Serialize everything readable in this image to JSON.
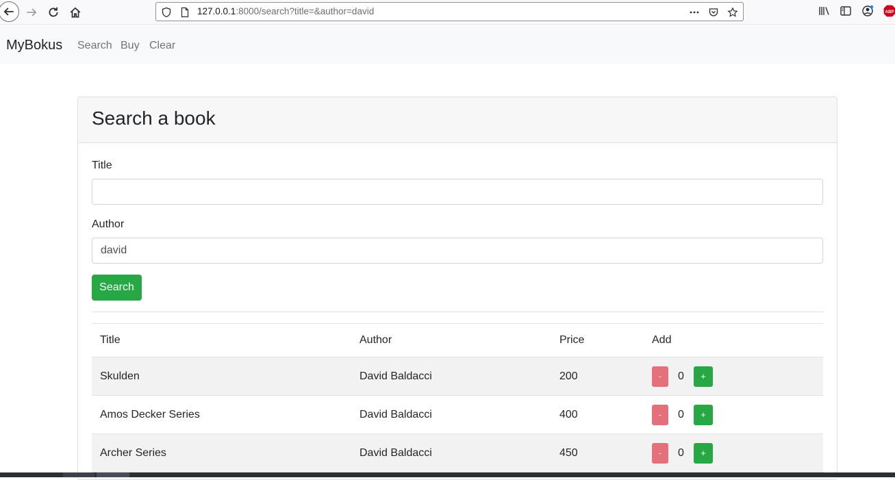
{
  "browser": {
    "url_host": "127.0.0.1",
    "url_rest": ":8000/search?title=&author=david"
  },
  "navbar": {
    "brand": "MyBokus",
    "links": [
      "Search",
      "Buy",
      "Clear"
    ]
  },
  "card": {
    "title": "Search a book",
    "title_label": "Title",
    "title_value": "",
    "author_label": "Author",
    "author_value": "david",
    "search_button": "Search"
  },
  "table": {
    "headers": [
      "Title",
      "Author",
      "Price",
      "Add"
    ],
    "rows": [
      {
        "title": "Skulden",
        "author": "David Baldacci",
        "price": "200",
        "qty": "0"
      },
      {
        "title": "Amos Decker Series",
        "author": "David Baldacci",
        "price": "400",
        "qty": "0"
      },
      {
        "title": "Archer Series",
        "author": "David Baldacci",
        "price": "450",
        "qty": "0"
      }
    ],
    "minus_label": "-",
    "plus_label": "+"
  },
  "colors": {
    "success": "#28a745",
    "danger_light": "#e4707c",
    "navbar_bg": "#f8f9fa"
  }
}
